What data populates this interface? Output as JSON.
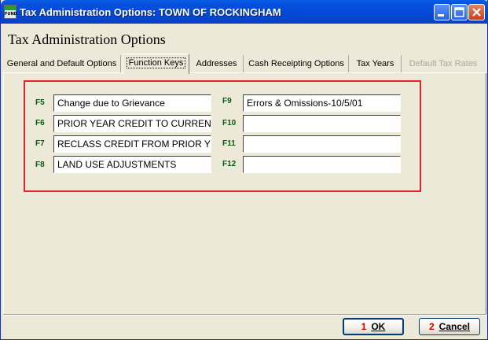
{
  "window": {
    "title": "Tax Administration Options: TOWN OF ROCKINGHAM",
    "app_icon_text": "FUND"
  },
  "header": {
    "title": "Tax Administration Options"
  },
  "tabs": [
    {
      "label": "General and Default Options",
      "state": "normal"
    },
    {
      "label": "Function Keys",
      "state": "active"
    },
    {
      "label": "Addresses",
      "state": "normal"
    },
    {
      "label": "Cash Receipting Options",
      "state": "normal"
    },
    {
      "label": "Tax Years",
      "state": "normal"
    },
    {
      "label": "Default Tax Rates",
      "state": "disabled"
    }
  ],
  "function_keys": {
    "left": [
      {
        "key": "F5",
        "value": "Change due to Grievance"
      },
      {
        "key": "F6",
        "value": "PRIOR YEAR CREDIT TO CURREN"
      },
      {
        "key": "F7",
        "value": "RECLASS CREDIT FROM PRIOR Y"
      },
      {
        "key": "F8",
        "value": "LAND USE ADJUSTMENTS"
      }
    ],
    "right": [
      {
        "key": "F9",
        "value": "Errors & Omissions-10/5/01"
      },
      {
        "key": "F10",
        "value": ""
      },
      {
        "key": "F11",
        "value": ""
      },
      {
        "key": "F12",
        "value": ""
      }
    ]
  },
  "buttons": {
    "ok": {
      "number": "1",
      "label": "OK"
    },
    "cancel": {
      "number": "2",
      "label": "Cancel"
    }
  },
  "colors": {
    "highlight_box": "#e32426",
    "key_label": "#0a5a0a",
    "button_number": "#cc0000"
  }
}
